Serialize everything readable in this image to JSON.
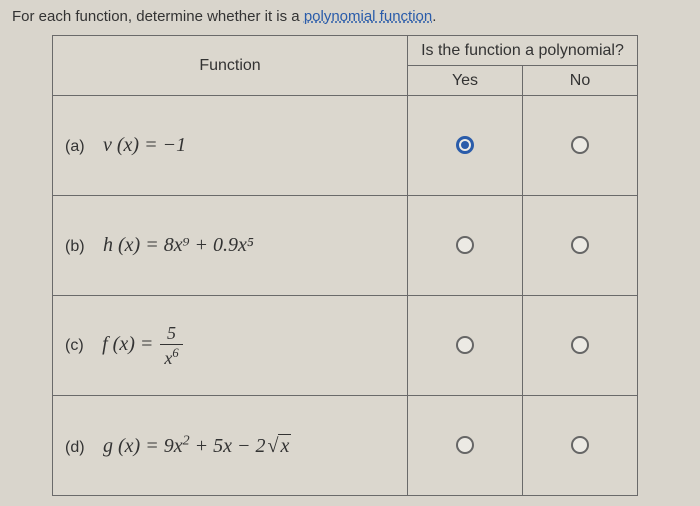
{
  "question_prefix": "For each function, determine whether it is a ",
  "question_link": "polynomial function",
  "question_suffix": ".",
  "headers": {
    "function": "Function",
    "question": "Is the function a polynomial?",
    "yes": "Yes",
    "no": "No"
  },
  "rows": [
    {
      "label": "(a)",
      "yes_selected": true,
      "no_selected": false
    },
    {
      "label": "(b)",
      "yes_selected": false,
      "no_selected": false
    },
    {
      "label": "(c)",
      "yes_selected": false,
      "no_selected": false
    },
    {
      "label": "(d)",
      "yes_selected": false,
      "no_selected": false
    }
  ],
  "functions": {
    "a_text": "v (x) = −1",
    "b_text": "h (x) = 8x⁹ + 0.9x⁵",
    "c_prefix": "f (x) = ",
    "c_num": "5",
    "c_den_base": "x",
    "c_den_exp": "6",
    "d_prefix": "g (x) = 9x",
    "d_exp": "2",
    "d_mid": " + 5x − 2",
    "d_rad": "x"
  }
}
